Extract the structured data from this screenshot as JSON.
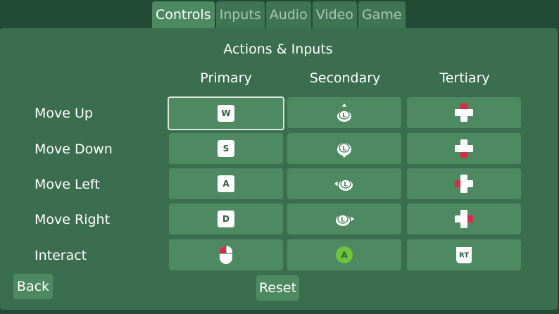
{
  "tabs": [
    "Controls",
    "Inputs",
    "Audio",
    "Video",
    "Game"
  ],
  "title": "Actions & Inputs",
  "columns": [
    "Primary",
    "Secondary",
    "Tertiary"
  ],
  "rows": [
    {
      "label": "Move Up",
      "primary_key": "W"
    },
    {
      "label": "Move Down",
      "primary_key": "S"
    },
    {
      "label": "Move Left",
      "primary_key": "A"
    },
    {
      "label": "Move Right",
      "primary_key": "D"
    },
    {
      "label": "Interact"
    }
  ],
  "interact": {
    "secondary_button": "A",
    "tertiary_button": "RT"
  },
  "buttons": {
    "back": "Back",
    "reset": "Reset"
  },
  "colors": {
    "background": "#234a35",
    "panel": "#3a6e4f",
    "cell": "#4d8a62",
    "dpad_accent": "#e0264a",
    "a_button": "#6fc33a"
  }
}
